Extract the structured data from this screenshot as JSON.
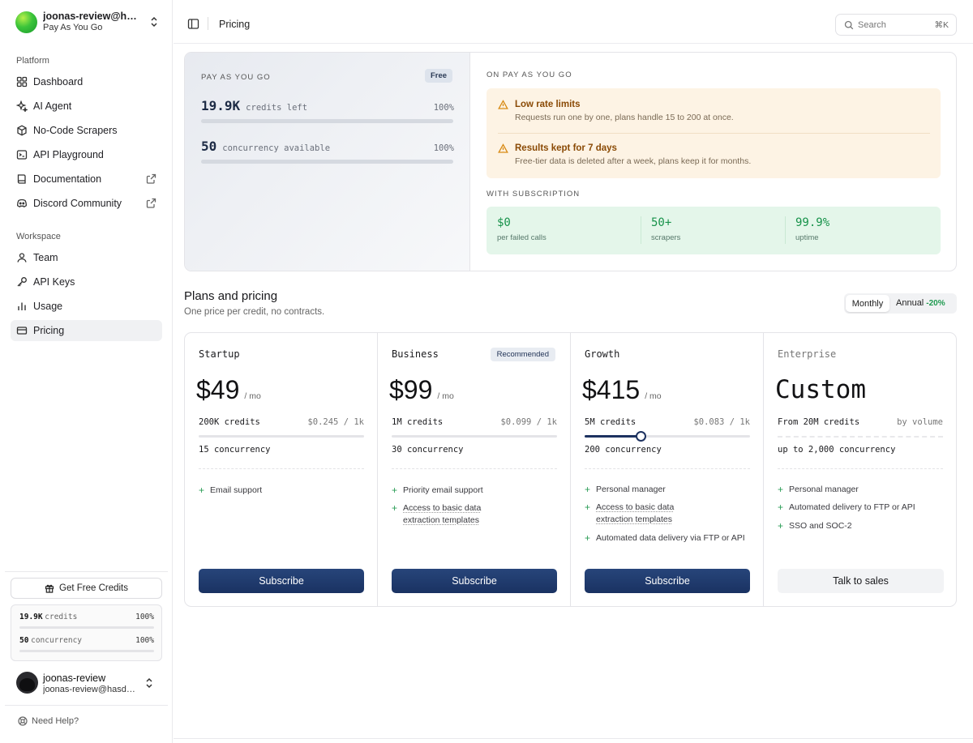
{
  "org": {
    "name": "joonas-review@hasdata.com",
    "plan": "Pay As You Go"
  },
  "sidebar": {
    "platform_label": "Platform",
    "platform_items": [
      {
        "label": "Dashboard",
        "icon": "grid-icon"
      },
      {
        "label": "AI Agent",
        "icon": "sparkle-icon"
      },
      {
        "label": "No-Code Scrapers",
        "icon": "cube-icon"
      },
      {
        "label": "API Playground",
        "icon": "terminal-icon"
      },
      {
        "label": "Documentation",
        "icon": "book-icon",
        "external": true
      },
      {
        "label": "Discord Community",
        "icon": "discord-icon",
        "external": true
      }
    ],
    "workspace_label": "Workspace",
    "workspace_items": [
      {
        "label": "Team",
        "icon": "users-icon"
      },
      {
        "label": "API Keys",
        "icon": "key-icon"
      },
      {
        "label": "Usage",
        "icon": "bar-chart-icon"
      },
      {
        "label": "Pricing",
        "icon": "credit-card-icon",
        "active": true
      }
    ],
    "free_credits_label": "Get Free Credits",
    "mini_usage": {
      "credits_value": "19.9K",
      "credits_label": "credits",
      "credits_pct": "100%",
      "credits_fraction": 1.0,
      "concurrency_value": "50",
      "concurrency_label": "concurrency",
      "concurrency_pct": "100%",
      "concurrency_fraction": 1.0
    },
    "user": {
      "name": "joonas-review",
      "email": "joonas-review@hasdata.com"
    },
    "help_label": "Need Help?"
  },
  "topbar": {
    "breadcrumb": "Pricing",
    "search_placeholder": "Search",
    "search_shortcut": "⌘K"
  },
  "usage": {
    "label": "PAY AS YOU GO",
    "badge": "Free",
    "credits_value": "19.9K",
    "credits_label": "credits left",
    "credits_pct": "100%",
    "credits_fraction": 1.0,
    "concurrency_value": "50",
    "concurrency_label": "concurrency available",
    "concurrency_pct": "100%",
    "concurrency_fraction": 1.0,
    "on_payg_label": "ON PAY AS YOU GO",
    "warnings": [
      {
        "title": "Low rate limits",
        "desc": "Requests run one by one, plans handle 15 to 200 at once."
      },
      {
        "title": "Results kept for 7 days",
        "desc": "Free-tier data is deleted after a week, plans keep it for months."
      }
    ],
    "with_sub_label": "WITH SUBSCRIPTION",
    "stats": [
      {
        "value": "$0",
        "label": "per failed calls"
      },
      {
        "value": "50+",
        "label": "scrapers"
      },
      {
        "value": "99.9%",
        "label": "uptime"
      }
    ]
  },
  "plans_header": {
    "title": "Plans and pricing",
    "subtitle": "One price per credit, no contracts.",
    "monthly_label": "Monthly",
    "annual_label": "Annual",
    "annual_discount": "-20%"
  },
  "plans": [
    {
      "name": "Startup",
      "price": "$49",
      "per": "/ mo",
      "credits": "200K credits",
      "rate": "$0.245 / 1k",
      "slider_fraction": 0.0,
      "concurrency": "15 concurrency",
      "features": [
        "Email support"
      ],
      "button": "Subscribe"
    },
    {
      "name": "Business",
      "badge": "Recommended",
      "price": "$99",
      "per": "/ mo",
      "credits": "1M credits",
      "rate": "$0.099 / 1k",
      "slider_fraction": 0.0,
      "concurrency": "30 concurrency",
      "features": [
        "Priority email support",
        "Access to basic data extraction templates"
      ],
      "button": "Subscribe"
    },
    {
      "name": "Growth",
      "price": "$415",
      "per": "/ mo",
      "credits": "5M credits",
      "rate": "$0.083 / 1k",
      "slider_fraction": 0.34,
      "concurrency": "200 concurrency",
      "features": [
        "Personal manager",
        "Access to basic data extraction templates",
        "Automated data delivery via FTP or API"
      ],
      "button": "Subscribe"
    },
    {
      "name": "Enterprise",
      "price": "Custom",
      "credits": "From 20M credits",
      "rate": "by volume",
      "concurrency": "up to 2,000 concurrency",
      "features": [
        "Personal manager",
        "Automated delivery to FTP or API",
        "SSO and SOC-2"
      ],
      "button": "Talk to sales"
    }
  ]
}
